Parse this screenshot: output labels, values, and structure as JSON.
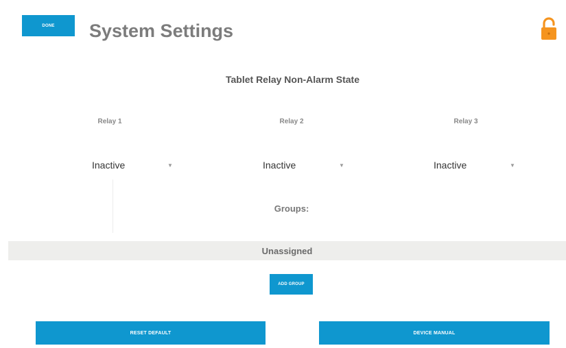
{
  "header": {
    "done_label": "DONE",
    "title": "System Settings",
    "lock_icon": "unlocked-padlock-icon",
    "lock_color": "#f5941f"
  },
  "relay_section": {
    "title": "Tablet Relay Non-Alarm State",
    "relays": [
      {
        "label": "Relay 1",
        "value": "Inactive"
      },
      {
        "label": "Relay 2",
        "value": "Inactive"
      },
      {
        "label": "Relay 3",
        "value": "Inactive"
      }
    ]
  },
  "groups": {
    "label": "Groups:",
    "unassigned_label": "Unassigned",
    "add_group_label": "ADD GROUP"
  },
  "footer": {
    "reset_label": "RESET DEFAULT",
    "manual_label": "DEVICE MANUAL"
  },
  "colors": {
    "accent": "#0f97cf",
    "title_gray": "#7c7c7c"
  }
}
